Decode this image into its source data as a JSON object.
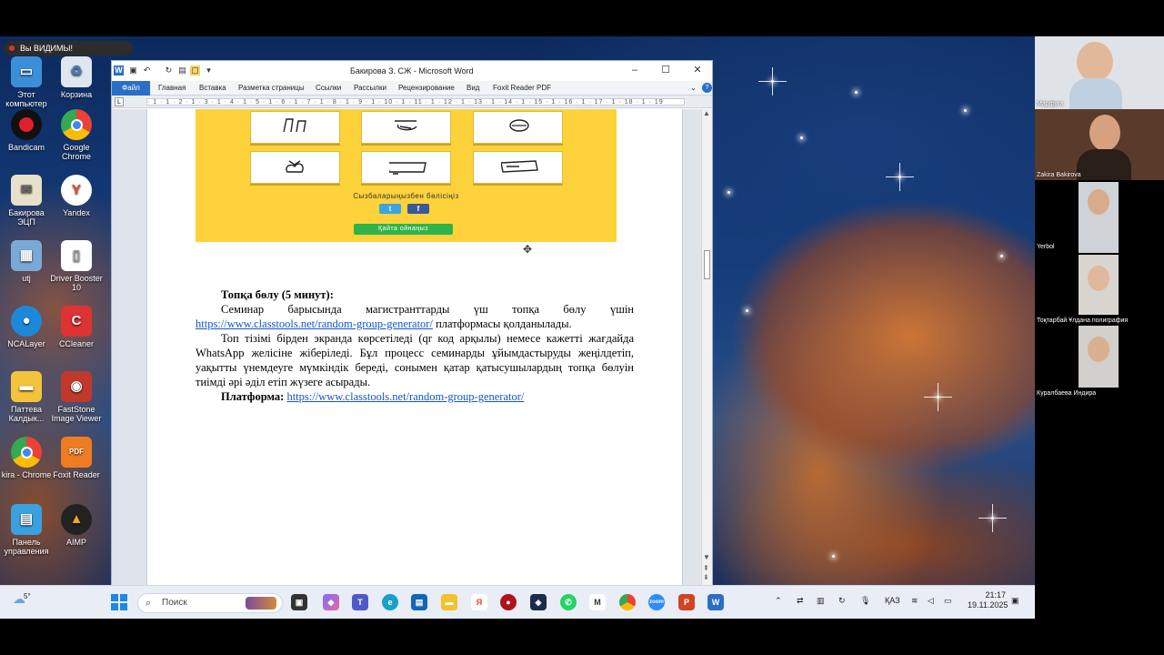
{
  "desktop": {
    "notification": "Вы ВИДИМЫ!",
    "icons": [
      {
        "label": "Этот компьютер"
      },
      {
        "label": "Корзина"
      },
      {
        "label": "Bandicam"
      },
      {
        "label": "Google Chrome"
      },
      {
        "label": "Бакирова ЭЦП"
      },
      {
        "label": "Yandex"
      },
      {
        "label": "utj"
      },
      {
        "label": "Driver Booster 10"
      },
      {
        "label": "NCALayer"
      },
      {
        "label": "CCleaner"
      },
      {
        "label": "Паттева Калдык..."
      },
      {
        "label": "FastStone Image Viewer"
      },
      {
        "label": "kira - Chrome"
      },
      {
        "label": "Foxit Reader"
      },
      {
        "label": "Панель управления"
      },
      {
        "label": "AIMP"
      }
    ]
  },
  "word": {
    "title": "Бакирова З. СЖ  -  Microsoft Word",
    "tabs": [
      "Файл",
      "Главная",
      "Вставка",
      "Разметка страницы",
      "Ссылки",
      "Рассылки",
      "Рецензирование",
      "Вид",
      "Foxit Reader PDF"
    ],
    "ruler_text": "· 1 · 1 · 2 · 1 · 3 · 1 · 4 · 1 · 5 · 1 · 6 · 1 · 7 · 1 · 8 · 1 · 9 · 1 · 10 · 1 · 11 · 1 · 12 · 1 · 13 · 1 · 14 · 1 · 15 · 1 · 16 · 1 · 17 · 1 · 18 · 1 · 19",
    "image": {
      "share_caption": "Сызбаларыңызбен бөлісіңіз",
      "twitter": "t",
      "facebook": "f",
      "replay": "Қайта ойнаңыз"
    },
    "doc": {
      "heading": "Топқа бөлу (5 минут):",
      "p1_text": "Семинар барысында магистранттарды үш топқа бөлу үшін ",
      "link": "https://www.classtools.net/random-group-generator/",
      "p1_tail": " платформасы қолданылады.",
      "p2": "Топ тізімі бірден экранда көрсетіледі (qr код арқылы) немесе кажетті жағдайда WhatsApp желісіне жіберіледі. Бұл процесс семинарды ұйымдастыруды жеңілдетіп, уақытты үнемдеуге мүмкіндік береді, сонымен қатар қатысушылардың топқа бөлуін тиімді әрі әділ етіп жүзеге асырады.",
      "platform_label": "Платформа:",
      "platform_link": "https://www.classtools.net/random-group-generator/"
    }
  },
  "participants": [
    {
      "name": "Марфуга"
    },
    {
      "name": "Zakira Bakirova"
    },
    {
      "name": "Yerbol"
    },
    {
      "name": "Тоқтарбай Ұлдана полиграфия"
    },
    {
      "name": "Куралбаева Индира"
    }
  ],
  "taskbar": {
    "weather": "5°",
    "search_placeholder": "Поиск",
    "lang": "ҚАЗ",
    "time": "21:17",
    "date": "19.11.2025"
  }
}
